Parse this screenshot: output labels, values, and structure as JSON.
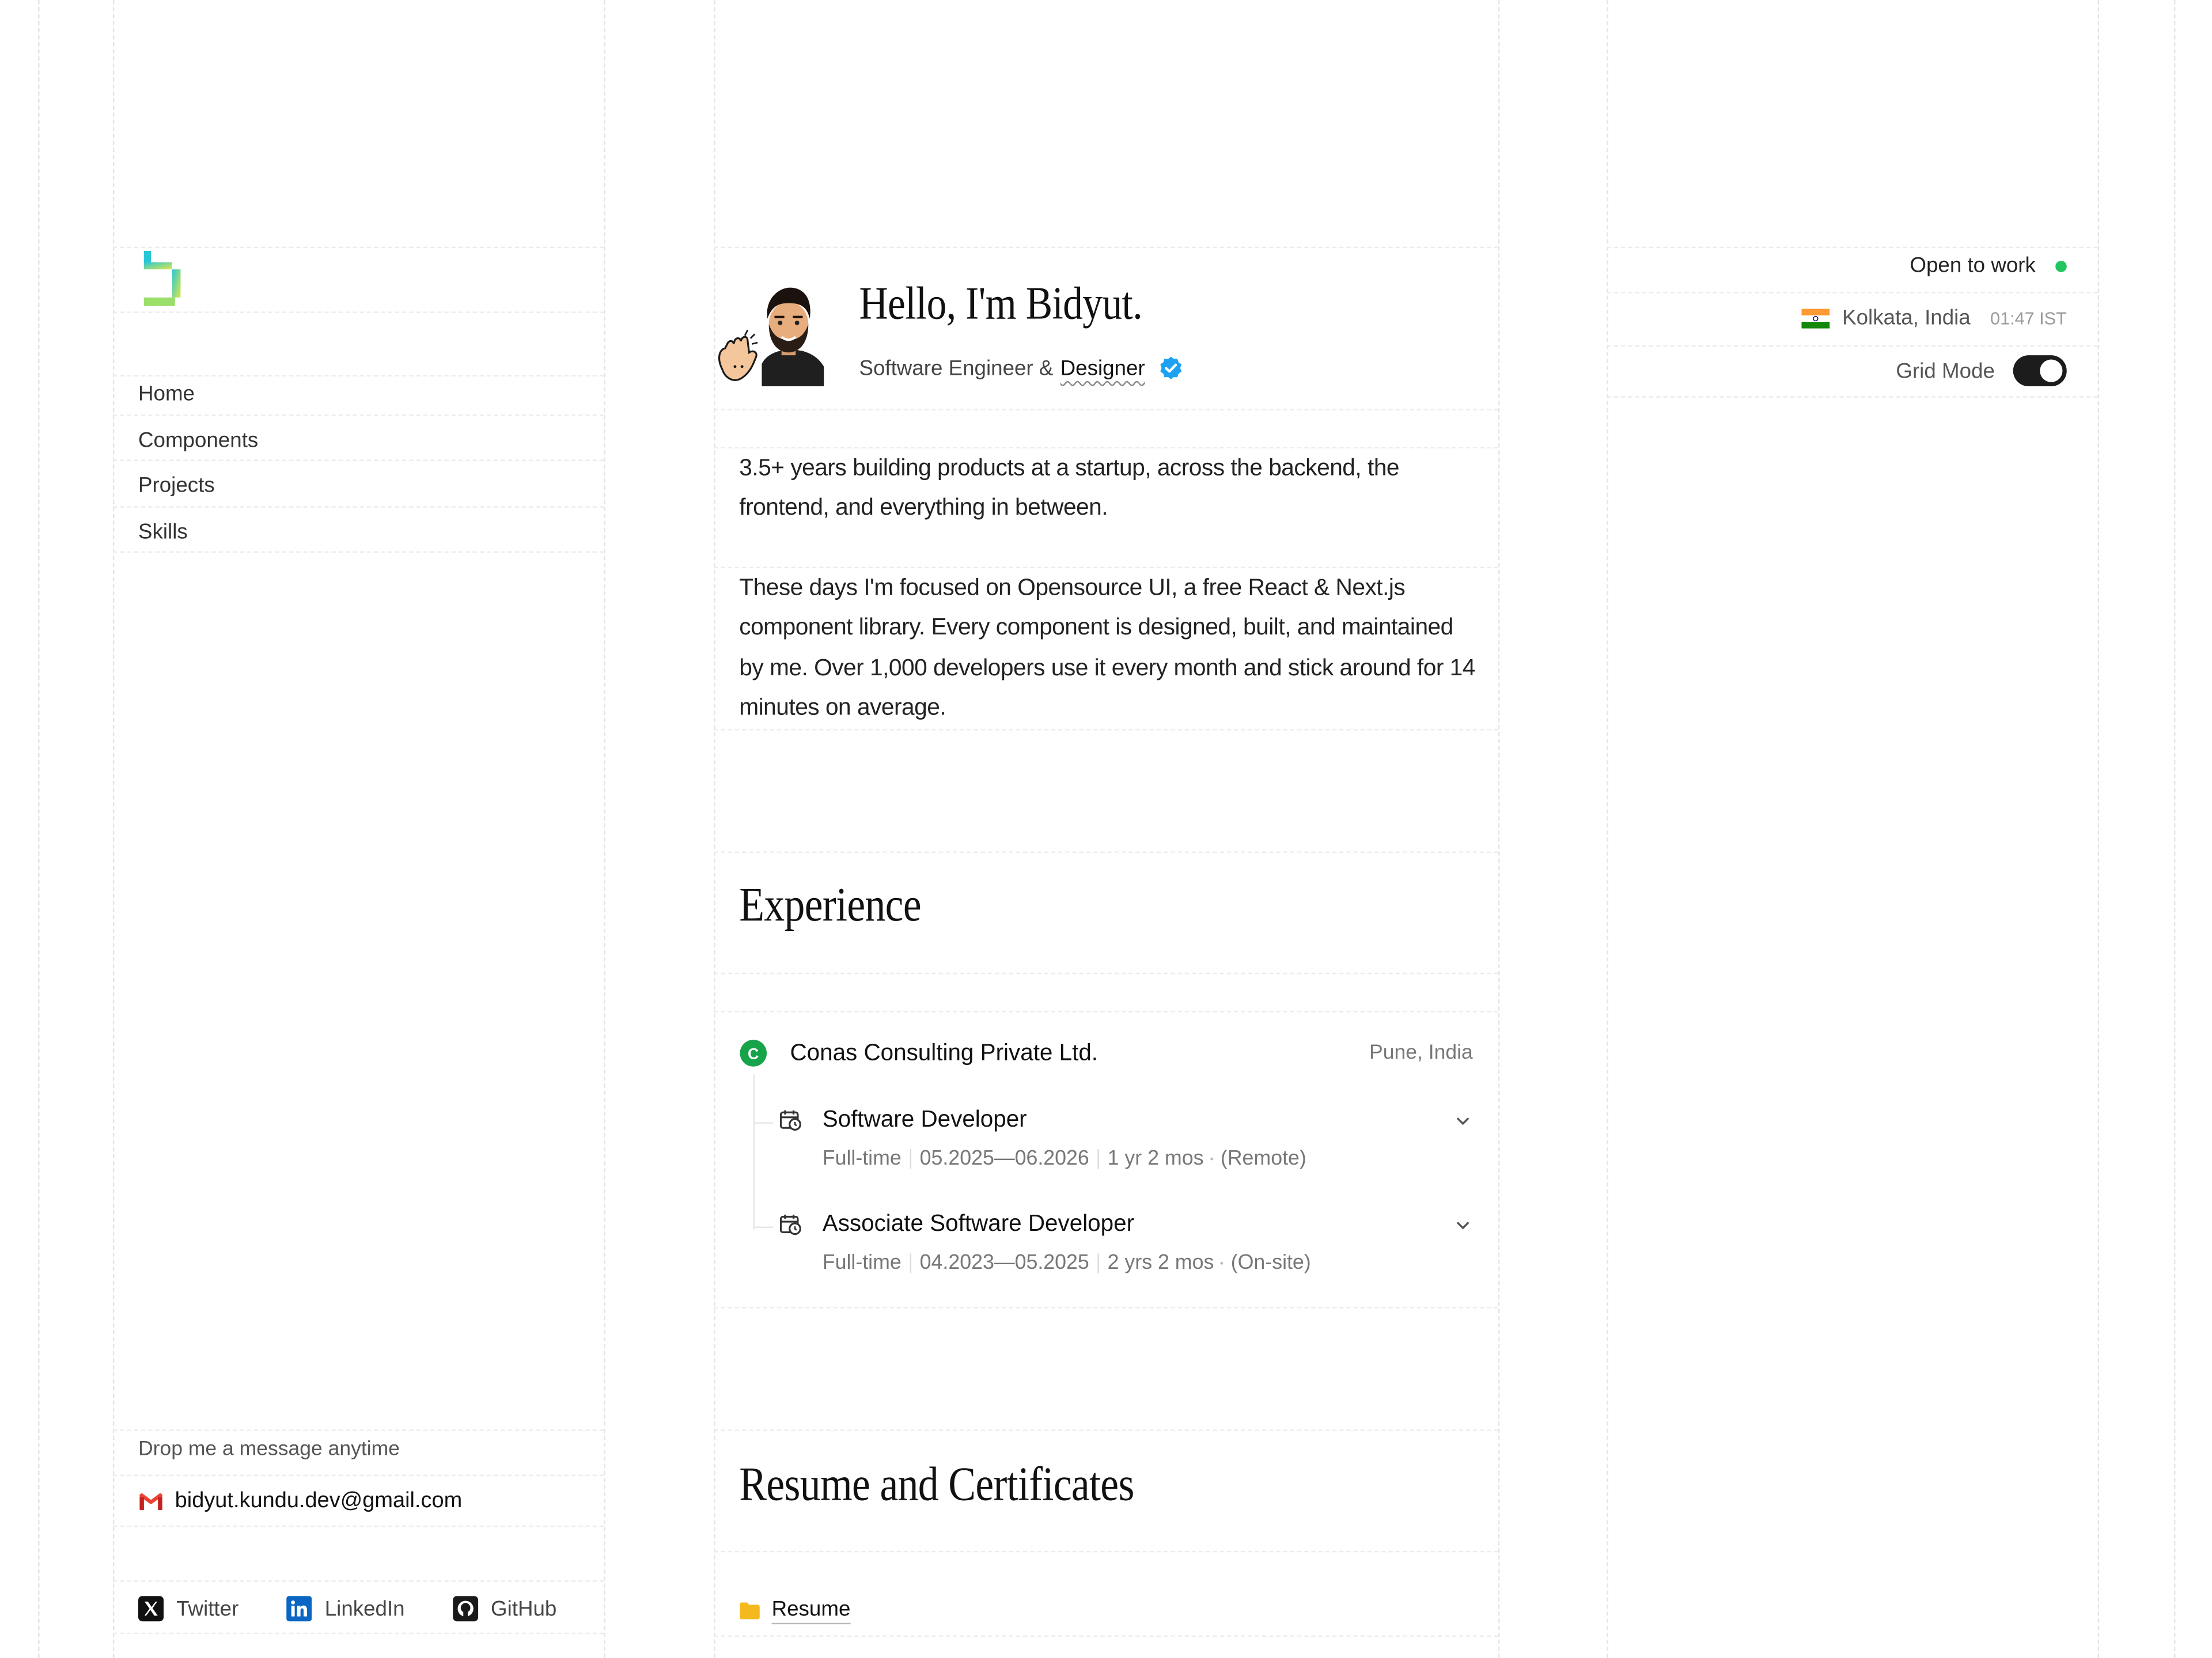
{
  "nav": {
    "items": [
      {
        "label": "Home"
      },
      {
        "label": "Components"
      },
      {
        "label": "Projects"
      },
      {
        "label": "Skills"
      }
    ]
  },
  "contact": {
    "prompt": "Drop me a message anytime",
    "email": "bidyut.kundu.dev@gmail.com"
  },
  "socials": [
    {
      "label": "Twitter",
      "icon": "x-icon"
    },
    {
      "label": "LinkedIn",
      "icon": "linkedin-icon"
    },
    {
      "label": "GitHub",
      "icon": "github-icon"
    }
  ],
  "profile": {
    "greeting": "Hello, I'm Bidyut.",
    "role_prefix": "Software Engineer &",
    "role_highlight": "Designer"
  },
  "bio": [
    "3.5+ years building products at a startup, across the backend, the frontend, and everything in between.",
    "These days I'm focused on Opensource UI, a free React & Next.js component library. Every component is designed, built, and maintained by me. Over 1,000 developers use it every month and stick around for 14 minutes on average."
  ],
  "experience": {
    "heading": "Experience",
    "company": {
      "logo_letter": "C",
      "name": "Conas Consulting Private Ltd.",
      "location": "Pune, India",
      "accent": "#16a34a"
    },
    "roles": [
      {
        "title": "Software Developer",
        "type": "Full-time",
        "period": "05.2025—06.2026",
        "duration": "1 yr 2 mos",
        "mode": "(Remote)"
      },
      {
        "title": "Associate Software Developer",
        "type": "Full-time",
        "period": "04.2023—05.2025",
        "duration": "2 yrs 2 mos",
        "mode": "(On-site)"
      }
    ]
  },
  "resume": {
    "heading": "Resume and Certificates",
    "items": [
      {
        "label": "Resume",
        "icon": "folder-icon"
      }
    ]
  },
  "status": {
    "open_to_work": "Open to work",
    "location": "Kolkata, India",
    "time": "01:47 IST",
    "grid_mode_label": "Grid Mode",
    "grid_mode_on": true,
    "status_color": "#22c55e"
  }
}
